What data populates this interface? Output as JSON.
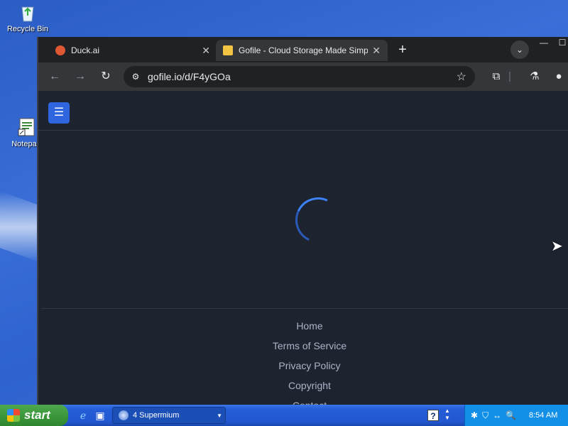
{
  "desktop": {
    "icons": [
      {
        "label": "Recycle Bin",
        "icon": "recycle-bin-icon"
      },
      {
        "label": "Notepad",
        "icon": "notepad-icon"
      }
    ]
  },
  "browser": {
    "tabs": [
      {
        "title": "Duck.ai",
        "icon": "duckduckgo-icon",
        "favicon_color": "#de5833",
        "close": "✕"
      },
      {
        "title": "Gofile - Cloud Storage Made Simple",
        "icon": "gofile-icon",
        "favicon_color": "#f4c542",
        "close": "✕"
      }
    ],
    "new_tab": "+",
    "tab_menu": "⌄",
    "window": {
      "minimize": "—",
      "maximize": "☐"
    },
    "toolbar": {
      "back": "←",
      "forward": "→",
      "reload": "↻",
      "site_info": "⚙",
      "url": "gofile.io/d/F4yGOa",
      "bookmark": "☆",
      "extensions": "⧉",
      "separator": "|",
      "labs": "⚗",
      "profile": "●"
    }
  },
  "page": {
    "menu_icon": "☰",
    "footer_links": [
      "Home",
      "Terms of Service",
      "Privacy Policy",
      "Copyright",
      "Contact"
    ]
  },
  "taskbar": {
    "start_label": "start",
    "quick_launch": [
      {
        "icon": "internet-explorer-icon",
        "glyph": "ℯ"
      },
      {
        "icon": "show-desktop-icon",
        "glyph": "▣"
      }
    ],
    "task_button": "4 Supermium",
    "help": "?",
    "tray_icons": [
      "✱",
      "⛉",
      "↔",
      "🔍"
    ],
    "clock": "8:54 AM"
  }
}
